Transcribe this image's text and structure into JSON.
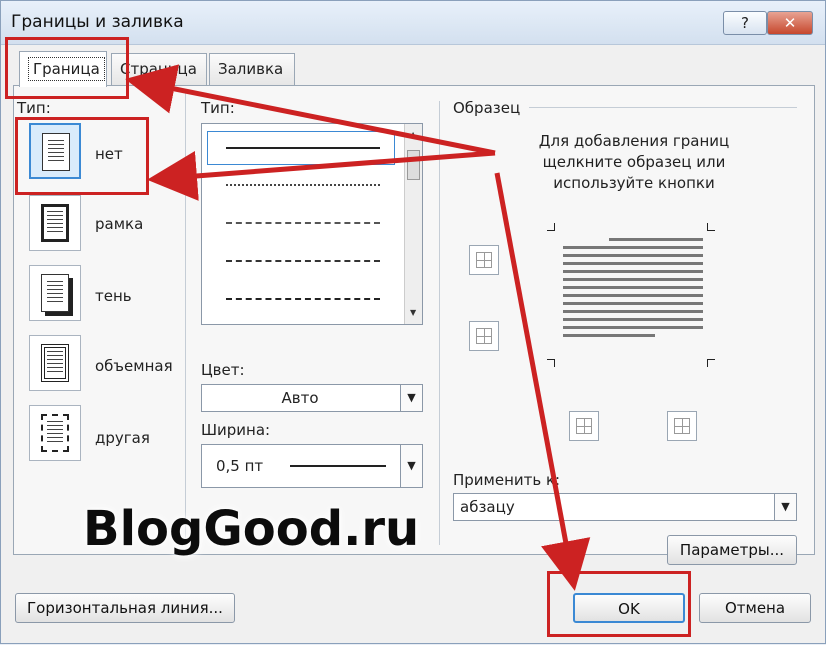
{
  "window": {
    "title": "Границы и заливка",
    "help_label": "?",
    "close_label": "✕"
  },
  "tabs": [
    {
      "label": "Граница",
      "active": true
    },
    {
      "label": "Страница",
      "active": false
    },
    {
      "label": "Заливка",
      "active": false
    }
  ],
  "settings": {
    "header": "Тип:",
    "items": [
      {
        "label": "нет",
        "icon": "none-border-icon",
        "selected": true
      },
      {
        "label": "рамка",
        "icon": "box-border-icon",
        "selected": false
      },
      {
        "label": "тень",
        "icon": "shadow-border-icon",
        "selected": false
      },
      {
        "label": "объемная",
        "icon": "3d-border-icon",
        "selected": false
      },
      {
        "label": "другая",
        "icon": "custom-border-icon",
        "selected": false
      }
    ]
  },
  "style": {
    "header": "Тип:",
    "line_styles": [
      "solid",
      "dotted",
      "dashed-small",
      "dashed",
      "dash-dot"
    ],
    "color_label": "Цвет:",
    "color_value": "Авто",
    "width_label": "Ширина:",
    "width_value": "0,5 пт"
  },
  "preview": {
    "header": "Образец",
    "instructions": "Для добавления границ щелкните образец или используйте кнопки",
    "apply_to_label": "Применить к:",
    "apply_to_value": "абзацу",
    "options_button": "Параметры..."
  },
  "footer": {
    "horizontal_line_button": "Горизонтальная линия...",
    "ok_button": "OK",
    "cancel_button": "Отмена"
  },
  "watermark": "BlogGood.ru",
  "colors": {
    "annotation_red": "#cc2222",
    "selection_blue": "#3b89d4"
  }
}
